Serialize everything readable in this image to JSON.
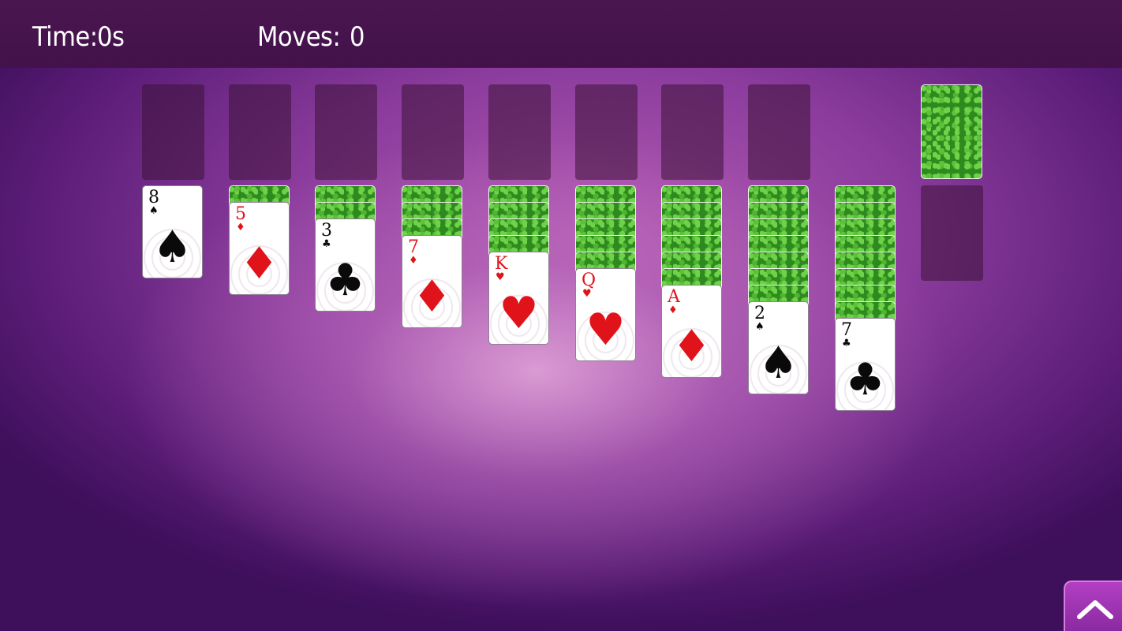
{
  "header": {
    "time_label": "Time:",
    "time_value": "0s",
    "moves_label": "Moves:",
    "moves_value": "0"
  },
  "foundations": {
    "count": 8
  },
  "stock": {
    "cards_remaining_visible": true,
    "card_back_theme": "green-clover"
  },
  "tableau": [
    {
      "face_down": 0,
      "face_up": {
        "rank": "8",
        "suit": "spade",
        "symbol": "♠",
        "color": "black"
      }
    },
    {
      "face_down": 1,
      "face_up": {
        "rank": "5",
        "suit": "diamond",
        "symbol": "♦",
        "color": "red"
      }
    },
    {
      "face_down": 2,
      "face_up": {
        "rank": "3",
        "suit": "club",
        "symbol": "♣",
        "color": "black"
      }
    },
    {
      "face_down": 3,
      "face_up": {
        "rank": "7",
        "suit": "diamond",
        "symbol": "♦",
        "color": "red"
      }
    },
    {
      "face_down": 4,
      "face_up": {
        "rank": "K",
        "suit": "heart",
        "symbol": "♥",
        "color": "red"
      }
    },
    {
      "face_down": 5,
      "face_up": {
        "rank": "Q",
        "suit": "heart",
        "symbol": "♥",
        "color": "red"
      }
    },
    {
      "face_down": 6,
      "face_up": {
        "rank": "A",
        "suit": "diamond",
        "symbol": "♦",
        "color": "red"
      }
    },
    {
      "face_down": 7,
      "face_up": {
        "rank": "2",
        "suit": "spade",
        "symbol": "♠",
        "color": "black"
      }
    },
    {
      "face_down": 8,
      "face_up": {
        "rank": "7",
        "suit": "club",
        "symbol": "♣",
        "color": "black"
      }
    }
  ],
  "colors": {
    "topbar": "#4a1650",
    "background": "#8a3b9c",
    "card_back": "#2e8a1e",
    "red_suit": "#e0131b",
    "black_suit": "#0a0a0a",
    "menu_button": "#a535b8"
  },
  "menu_button": {
    "icon": "chevron-up-icon"
  }
}
